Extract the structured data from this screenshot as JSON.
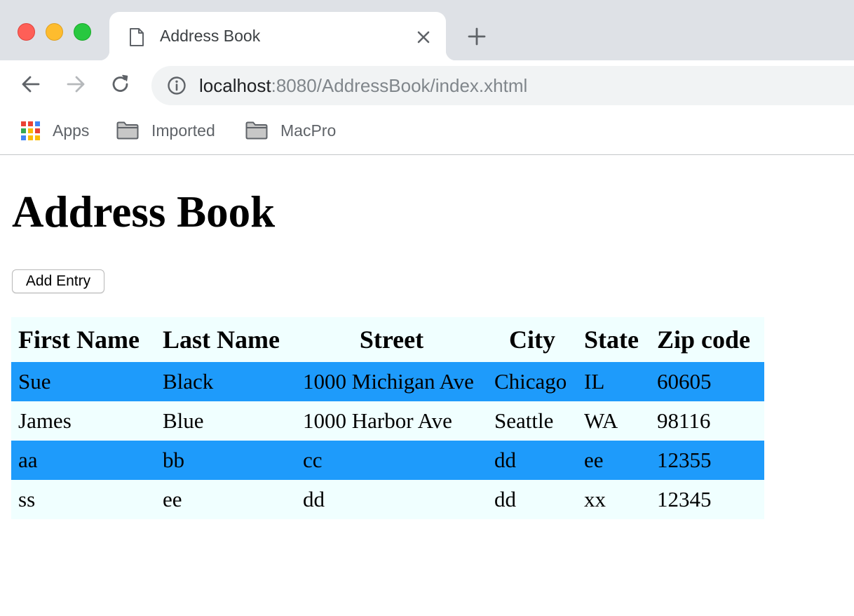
{
  "browser": {
    "tab_title": "Address Book",
    "url_host": "localhost",
    "url_rest": ":8080/AddressBook/index.xhtml",
    "bookmarks": [
      {
        "label": "Apps",
        "icon": "apps-grid-icon"
      },
      {
        "label": "Imported",
        "icon": "folder-icon"
      },
      {
        "label": "MacPro",
        "icon": "folder-icon"
      }
    ],
    "colors": {
      "titlebar": "#dee1e6",
      "omnibox": "#f1f3f4",
      "close_red": "#fe5f57",
      "minimize_yellow": "#febc2e",
      "zoom_green": "#28c840"
    }
  },
  "page": {
    "title": "Address Book",
    "add_button_label": "Add Entry",
    "table": {
      "headers": [
        "First Name",
        "Last Name",
        "Street",
        "City",
        "State",
        "Zip code"
      ],
      "rows": [
        [
          "Sue",
          "Black",
          "1000 Michigan Ave",
          "Chicago",
          "IL",
          "60605"
        ],
        [
          "James",
          "Blue",
          "1000 Harbor Ave",
          "Seattle",
          "WA",
          "98116"
        ],
        [
          "aa",
          "bb",
          "cc",
          "dd",
          "ee",
          "12355"
        ],
        [
          "ss",
          "ee",
          "dd",
          "dd",
          "xx",
          "12345"
        ]
      ],
      "colors": {
        "header_bg": "#f0ffff",
        "odd_row_bg": "#1e9bfb",
        "even_row_bg": "#f0ffff"
      }
    }
  }
}
